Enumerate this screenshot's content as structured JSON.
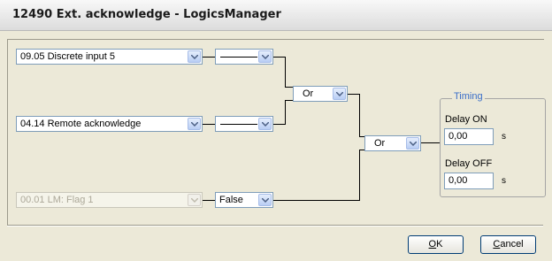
{
  "window": {
    "title": "12490 Ext. acknowledge - LogicsManager"
  },
  "inputs": [
    {
      "value": "09.05 Discrete input 5",
      "operator": ""
    },
    {
      "value": "04.14 Remote acknowledge",
      "operator": ""
    },
    {
      "value": "00.01 LM: Flag 1",
      "operator": "False"
    }
  ],
  "gates": {
    "gate1": "Or",
    "gate2": "Or"
  },
  "timing": {
    "title": "Timing",
    "delay_on_label": "Delay ON",
    "delay_on_value": "0,00",
    "delay_on_unit": "s",
    "delay_off_label": "Delay OFF",
    "delay_off_value": "0,00",
    "delay_off_unit": "s"
  },
  "buttons": {
    "ok": "OK",
    "ok_accel": "O",
    "ok_rest": "K",
    "cancel": "Cancel",
    "cancel_accel": "C",
    "cancel_rest": "ancel"
  }
}
